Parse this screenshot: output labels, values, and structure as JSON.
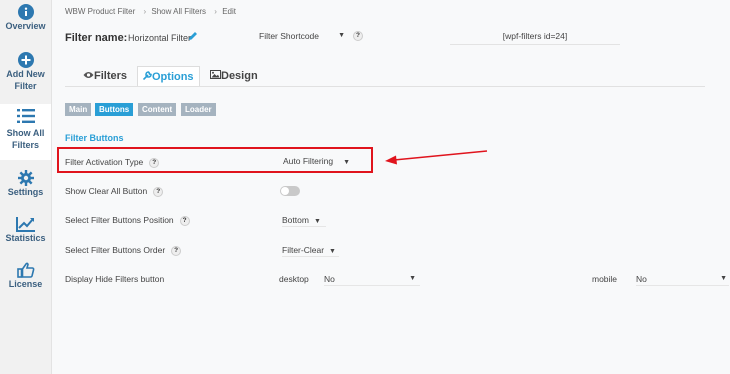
{
  "sidebar": {
    "items": [
      {
        "label_1": "Overview",
        "label_2": "",
        "icon": "info-icon"
      },
      {
        "label_1": "Add New",
        "label_2": "Filter",
        "icon": "plus-circle-icon"
      },
      {
        "label_1": "Show All",
        "label_2": "Filters",
        "icon": "list-icon",
        "active": true
      },
      {
        "label_1": "Settings",
        "label_2": "",
        "icon": "gear-icon"
      },
      {
        "label_1": "Statistics",
        "label_2": "",
        "icon": "chart-line-icon"
      },
      {
        "label_1": "License",
        "label_2": "",
        "icon": "thumbs-up-icon"
      }
    ]
  },
  "breadcrumb": {
    "items": [
      "WBW Product Filter",
      "Show All Filters",
      "Edit"
    ],
    "separator": "›"
  },
  "filter": {
    "name_label": "Filter name:",
    "name_value": "Horizontal Filter",
    "shortcode_select": "Filter Shortcode",
    "shortcode_value": "[wpf-filters id=24]"
  },
  "tabs": [
    {
      "label": "Filters",
      "icon": "eye-icon"
    },
    {
      "label": "Options",
      "icon": "wrench-icon",
      "active": true
    },
    {
      "label": "Design",
      "icon": "image-icon"
    }
  ],
  "subtabs": [
    {
      "label": "Main"
    },
    {
      "label": "Buttons",
      "active": true
    },
    {
      "label": "Content"
    },
    {
      "label": "Loader"
    }
  ],
  "section": {
    "title": "Filter Buttons"
  },
  "rows": {
    "activation_type": {
      "label": "Filter Activation Type",
      "value": "Auto Filtering"
    },
    "show_clear_all": {
      "label": "Show Clear All Button",
      "enabled": false
    },
    "buttons_position": {
      "label": "Select Filter Buttons Position",
      "value": "Bottom"
    },
    "buttons_order": {
      "label": "Select Filter Buttons Order",
      "value": "Filter-Clear"
    },
    "hide_filters": {
      "label": "Display Hide Filters button",
      "desktop_label": "desktop",
      "desktop_value": "No",
      "mobile_label": "mobile",
      "mobile_value": "No"
    }
  },
  "help_glyph": "?",
  "dropdown_glyph": "▼",
  "colors": {
    "accent": "#2a9fd6",
    "sidebar_icon": "#2d78b0",
    "highlight": "#e0141d"
  }
}
